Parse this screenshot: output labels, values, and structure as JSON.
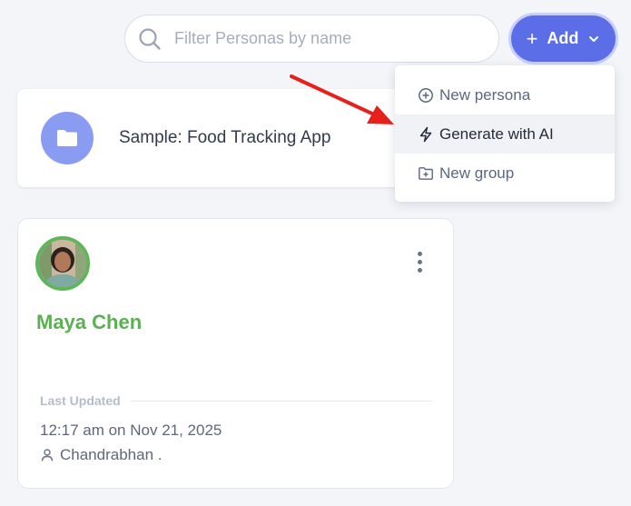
{
  "search": {
    "placeholder": "Filter Personas by name",
    "value": ""
  },
  "add_button": {
    "label": "Add"
  },
  "menu": {
    "items": [
      {
        "label": "New persona",
        "icon": "plus-circle-icon"
      },
      {
        "label": "Generate with AI",
        "icon": "lightning-icon"
      },
      {
        "label": "New group",
        "icon": "folder-plus-icon"
      }
    ]
  },
  "folder_card": {
    "title": "Sample: Food Tracking App",
    "icon": "folder-icon"
  },
  "persona_card": {
    "name": "Maya Chen",
    "last_updated_label": "Last Updated",
    "updated_time": "12:17 am on Nov 21, 2025",
    "updated_by": "Chandrabhan ."
  },
  "colors": {
    "accent": "#5b6ee8",
    "persona_name": "#5bb152",
    "folder_avatar": "#8a9cf1",
    "arrow": "#e8201c"
  }
}
